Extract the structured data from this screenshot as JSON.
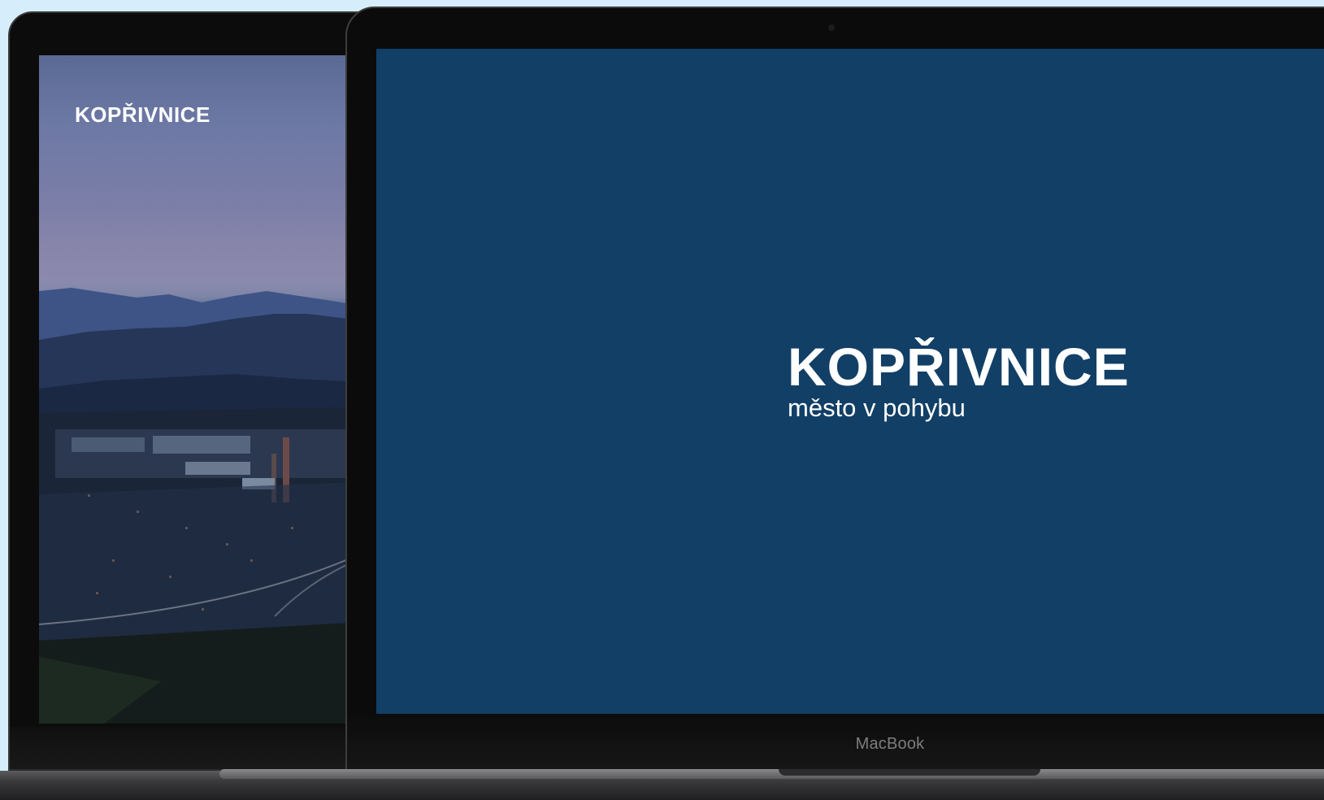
{
  "back_laptop": {
    "logo_text": "KOPŘIVNICE"
  },
  "front_laptop": {
    "title": "KOPŘIVNICE",
    "subtitle": "město v pohybu",
    "model_label": "MacBook"
  },
  "colors": {
    "background": "#d6eefb",
    "screen_blue": "#123f66",
    "bezel": "#0b0b0b"
  }
}
